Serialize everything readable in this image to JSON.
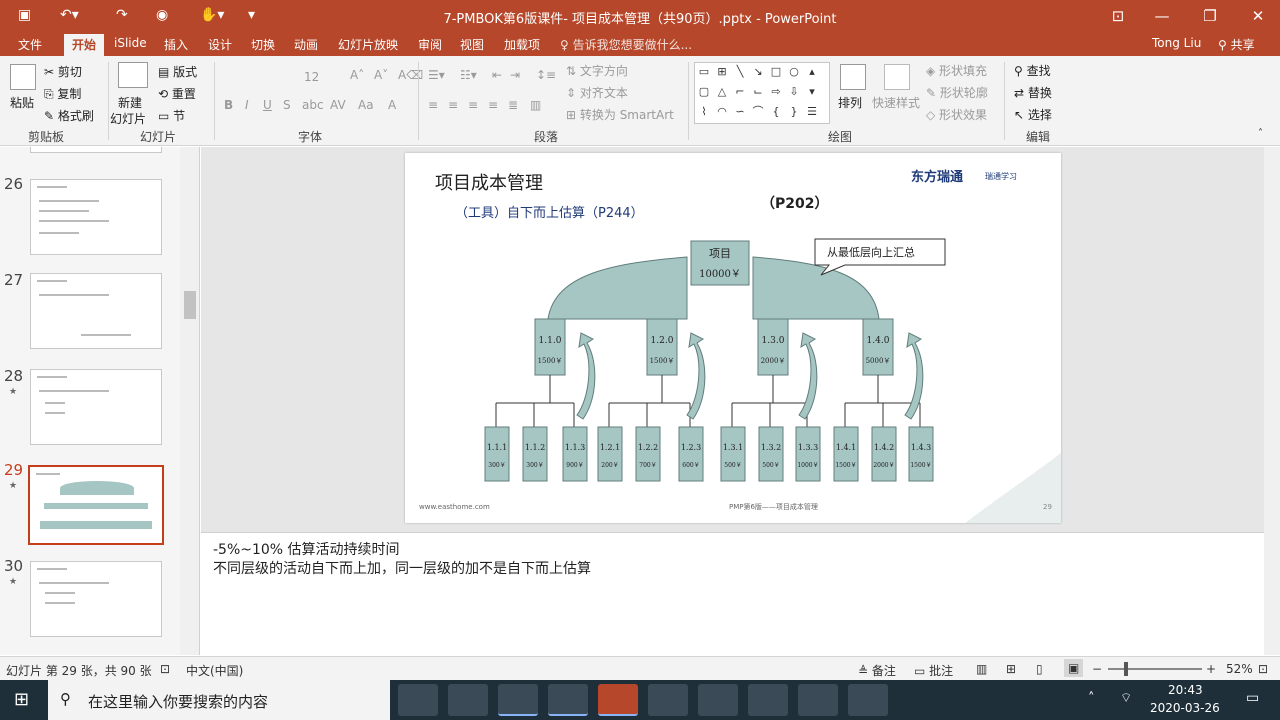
{
  "window": {
    "title": "7-PMBOK第6版课件- 项目成本管理（共90页）.pptx - PowerPoint",
    "menu": [
      "文件",
      "开始",
      "iSlide",
      "插入",
      "设计",
      "切换",
      "动画",
      "幻灯片放映",
      "审阅",
      "视图",
      "加载项"
    ],
    "active_tab": "开始",
    "tell_me": "告诉我您想要做什么...",
    "user": "Tong Liu",
    "share": "共享"
  },
  "ribbon": {
    "clipboard": {
      "paste": "粘贴",
      "cut": "剪切",
      "copy": "复制",
      "format_painter": "格式刷",
      "group": "剪贴板"
    },
    "slides": {
      "new_slide_1": "新建",
      "new_slide_2": "幻灯片",
      "layout": "版式",
      "reset": "重置",
      "section": "节",
      "group": "幻灯片"
    },
    "font": {
      "size": "12",
      "group": "字体"
    },
    "paragraph": {
      "text_direction": "文字方向",
      "align_text": "对齐文本",
      "smartart": "转换为 SmartArt",
      "group": "段落"
    },
    "drawing": {
      "arrange": "排列",
      "quick_styles": "快速样式",
      "shape_fill": "形状填充",
      "shape_outline": "形状轮廓",
      "shape_effects": "形状效果",
      "group": "绘图"
    },
    "editing": {
      "find": "查找",
      "replace": "替换",
      "select": "选择",
      "group": "编辑"
    }
  },
  "thumbnails": [
    {
      "num": "26",
      "star": ""
    },
    {
      "num": "27",
      "star": ""
    },
    {
      "num": "28",
      "star": "★"
    },
    {
      "num": "29",
      "star": "★"
    },
    {
      "num": "30",
      "star": "★"
    }
  ],
  "slide": {
    "title": "项目成本管理",
    "subtitle": "（工具）自下而上估算（P244）",
    "page_ref": "（P202）",
    "logo_text": "东方瑞通",
    "logo_sub": "瑞通学习",
    "callout": "从最低层向上汇总",
    "root": {
      "label": "项目",
      "value": "10000￥"
    },
    "level2": [
      {
        "id": "1.1.0",
        "value": "1500￥"
      },
      {
        "id": "1.2.0",
        "value": "1500￥"
      },
      {
        "id": "1.3.0",
        "value": "2000￥"
      },
      {
        "id": "1.4.0",
        "value": "5000￥"
      }
    ],
    "level3": [
      {
        "id": "1.1.1",
        "value": "300￥"
      },
      {
        "id": "1.1.2",
        "value": "300￥"
      },
      {
        "id": "1.1.3",
        "value": "900￥"
      },
      {
        "id": "1.2.1",
        "value": "200￥"
      },
      {
        "id": "1.2.2",
        "value": "700￥"
      },
      {
        "id": "1.2.3",
        "value": "600￥"
      },
      {
        "id": "1.3.1",
        "value": "500￥"
      },
      {
        "id": "1.3.2",
        "value": "500￥"
      },
      {
        "id": "1.3.3",
        "value": "1000￥"
      },
      {
        "id": "1.4.1",
        "value": "1500￥"
      },
      {
        "id": "1.4.2",
        "value": "2000￥"
      },
      {
        "id": "1.4.3",
        "value": "1500￥"
      }
    ],
    "footer_left": "www.easthome.com",
    "footer_center": "PMP第6版——项目成本管理",
    "page_no": "29"
  },
  "notes": {
    "line1": "-5%~10%  估算活动持续时间",
    "line2": "不同层级的活动自下而上加，同一层级的加不是自下而上估算"
  },
  "status": {
    "slide_info": "幻灯片 第 29 张，共 90 张",
    "language": "中文(中国)",
    "notes": "备注",
    "comments": "批注",
    "zoom": "52%"
  },
  "taskbar": {
    "search_placeholder": "在这里输入你要搜索的内容",
    "time": "20:43",
    "date": "2020-03-26"
  }
}
